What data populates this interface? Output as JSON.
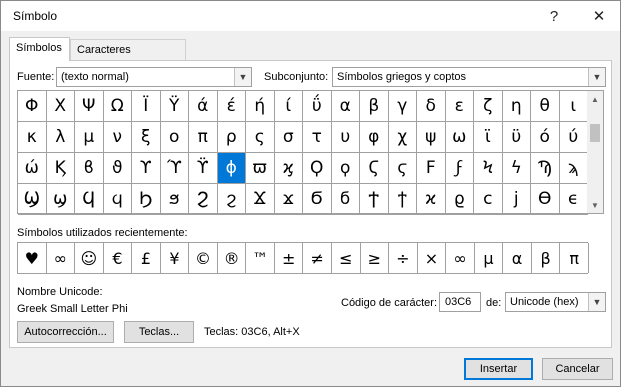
{
  "window": {
    "title": "Símbolo",
    "help_icon": "question-mark-icon",
    "close_icon": "close-icon"
  },
  "tabs": [
    {
      "label": "Símbolos",
      "active": true
    },
    {
      "label": "Caracteres especiales",
      "active": false
    }
  ],
  "font": {
    "label": "Fuente:",
    "value": "(texto normal)"
  },
  "subset": {
    "label": "Subconjunto:",
    "value": "Símbolos griegos y coptos"
  },
  "symbols": [
    "Φ",
    "Χ",
    "Ψ",
    "Ω",
    "Ϊ",
    "Ϋ",
    "ά",
    "έ",
    "ή",
    "ί",
    "ΰ",
    "α",
    "β",
    "γ",
    "δ",
    "ε",
    "ζ",
    "η",
    "θ",
    "ι",
    "κ",
    "λ",
    "μ",
    "ν",
    "ξ",
    "ο",
    "π",
    "ρ",
    "ς",
    "σ",
    "τ",
    "υ",
    "φ",
    "χ",
    "ψ",
    "ω",
    "ϊ",
    "ϋ",
    "ό",
    "ύ",
    "ώ",
    "Ϗ",
    "ϐ",
    "ϑ",
    "ϒ",
    "ϓ",
    "ϔ",
    "ϕ",
    "ϖ",
    "ϗ",
    "Ϙ",
    "ϙ",
    "Ϛ",
    "ϛ",
    "Ϝ",
    "ϝ",
    "Ϟ",
    "ϟ",
    "Ϡ",
    "ϡ",
    "Ϣ",
    "ϣ",
    "Ϥ",
    "ϥ",
    "Ϧ",
    "ϧ",
    "Ϩ",
    "ϩ",
    "Ϫ",
    "ϫ",
    "Ϭ",
    "ϭ",
    "Ϯ",
    "ϯ",
    "ϰ",
    "ϱ",
    "ϲ",
    "ϳ",
    "ϴ",
    "ϵ"
  ],
  "selected_symbol": "ϕ",
  "recent_label": "Símbolos utilizados recientemente:",
  "recent_symbols": [
    "♥",
    "∞",
    "☺",
    "€",
    "£",
    "¥",
    "©",
    "®",
    "™",
    "±",
    "≠",
    "≤",
    "≥",
    "÷",
    "×",
    "∞",
    "µ",
    "α",
    "β",
    "π"
  ],
  "unicode_name_label": "Nombre Unicode:",
  "unicode_name_value": "Greek Small Letter Phi",
  "char_code_label": "Código de carácter:",
  "char_code_value": "03C6",
  "from_label": "de:",
  "from_value": "Unicode (hex)",
  "buttons": {
    "autocorrect": "Autocorrección...",
    "keys": "Teclas...",
    "insert": "Insertar",
    "cancel": "Cancelar"
  },
  "shortcut_text": "Teclas: 03C6, Alt+X"
}
